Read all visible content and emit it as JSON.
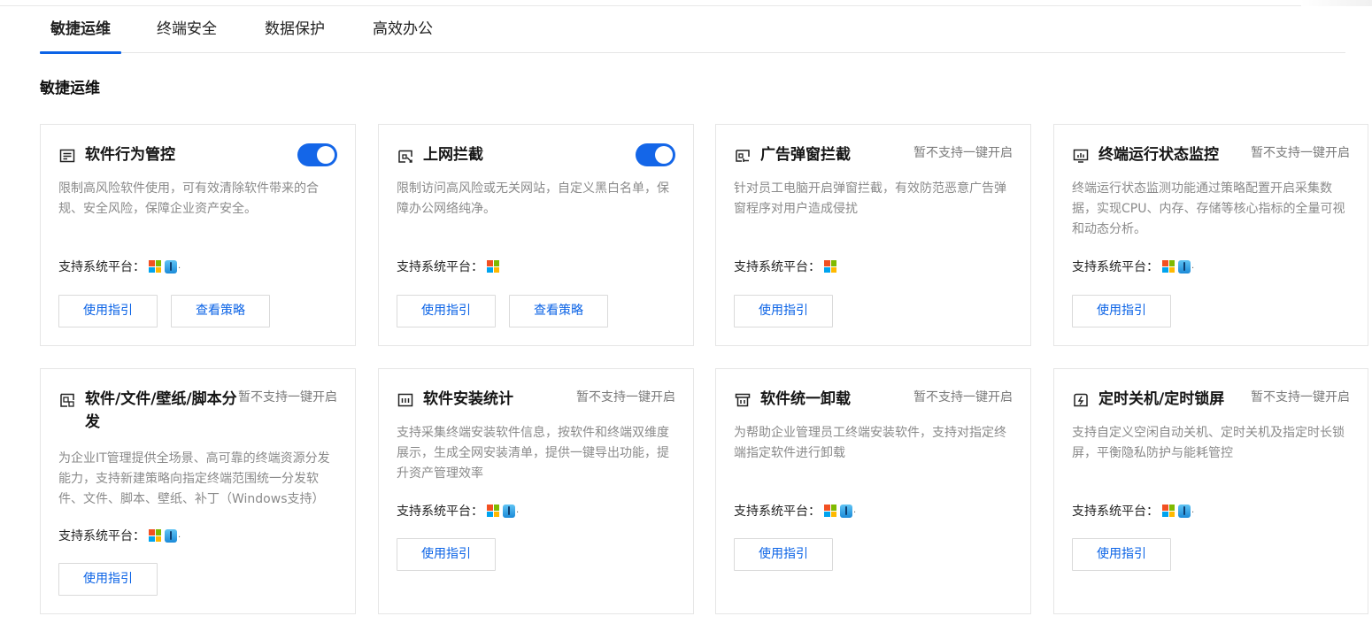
{
  "tabs": [
    "敏捷运维",
    "终端安全",
    "数据保护",
    "高效办公"
  ],
  "section_title": "敏捷运维",
  "platform_label": "支持系统平台：",
  "colors": {
    "accent": "#0b63e6",
    "toggle_on": "#1466e8"
  },
  "cards": [
    {
      "icon": "list-icon",
      "title": "软件行为管控",
      "toggle": "on",
      "status": "",
      "desc": "限制高风险软件使用，可有效清除软件带来的合规、安全风险，保障企业资产安全。",
      "platforms": [
        "windows",
        "mac"
      ],
      "buttons": [
        "使用指引",
        "查看策略"
      ]
    },
    {
      "icon": "block-icon",
      "title": "上网拦截",
      "toggle": "on",
      "status": "",
      "desc": "限制访问高风险或无关网站，自定义黑白名单，保障办公网络纯净。",
      "platforms": [
        "windows"
      ],
      "buttons": [
        "使用指引",
        "查看策略"
      ]
    },
    {
      "icon": "popup-block-icon",
      "title": "广告弹窗拦截",
      "toggle": "",
      "status": "暂不支持一键开启",
      "desc": "针对员工电脑开启弹窗拦截，有效防范恶意广告弹窗程序对用户造成侵扰",
      "platforms": [
        "windows"
      ],
      "buttons": [
        "使用指引"
      ]
    },
    {
      "icon": "monitor-icon",
      "title": "终端运行状态监控",
      "toggle": "",
      "status": "暂不支持一键开启",
      "desc": "终端运行状态监测功能通过策略配置开启采集数据，实现CPU、内存、存储等核心指标的全量可视和动态分析。",
      "platforms": [
        "windows",
        "mac"
      ],
      "buttons": [
        "使用指引"
      ]
    },
    {
      "icon": "distribute-icon",
      "title": "软件/文件/壁纸/脚本分发",
      "toggle": "",
      "status": "暂不支持一键开启",
      "desc": "为企业IT管理提供全场景、高可靠的终端资源分发能力，支持新建策略向指定终端范围统一分发软件、文件、脚本、壁纸、补丁（Windows支持）",
      "platforms": [
        "windows",
        "mac"
      ],
      "buttons": [
        "使用指引"
      ]
    },
    {
      "icon": "stats-icon",
      "title": "软件安装统计",
      "toggle": "",
      "status": "暂不支持一键开启",
      "desc": "支持采集终端安装软件信息，按软件和终端双维度展示，生成全网安装清单，提供一键导出功能，提升资产管理效率",
      "platforms": [
        "windows",
        "mac"
      ],
      "buttons": [
        "使用指引"
      ]
    },
    {
      "icon": "uninstall-icon",
      "title": "软件统一卸载",
      "toggle": "",
      "status": "暂不支持一键开启",
      "desc": "为帮助企业管理员工终端安装软件，支持对指定终端指定软件进行卸载",
      "platforms": [
        "windows",
        "mac"
      ],
      "buttons": [
        "使用指引"
      ]
    },
    {
      "icon": "timer-icon",
      "title": "定时关机/定时锁屏",
      "toggle": "",
      "status": "暂不支持一键开启",
      "desc": "支持自定义空闲自动关机、定时关机及指定时长锁屏，平衡隐私防护与能耗管控",
      "platforms": [
        "windows",
        "mac"
      ],
      "buttons": [
        "使用指引"
      ]
    }
  ]
}
